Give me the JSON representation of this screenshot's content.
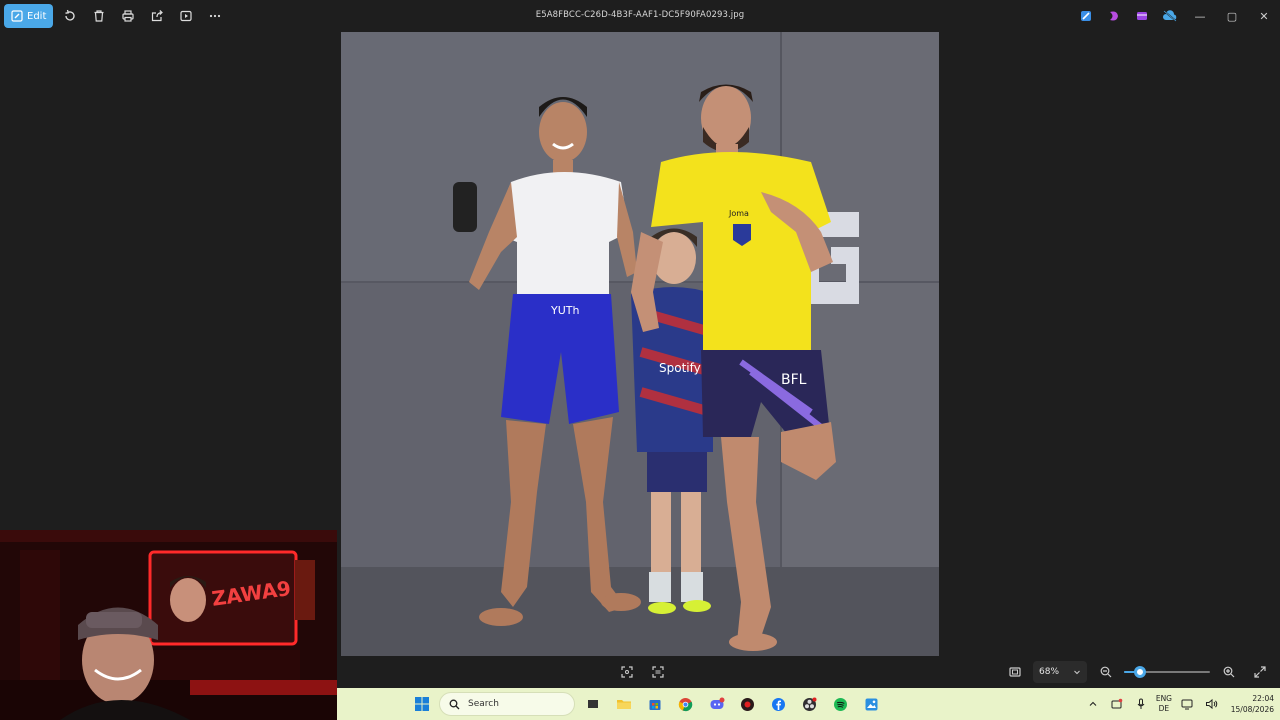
{
  "window": {
    "filename": "E5A8FBCC-C26D-4B3F-AAF1-DC5F90FA0293.jpg",
    "edit_label": "Edit",
    "toolbar_icons": [
      "rotate-icon",
      "delete-icon",
      "print-icon",
      "share-icon",
      "slideshow-icon",
      "more-icon"
    ],
    "controls": {
      "minimize": "—",
      "maximize": "▢",
      "close": "✕"
    }
  },
  "bottom_bar": {
    "zoom_value": "68%",
    "zoom_level": 0.13
  },
  "webcam": {
    "sign_text": "ZAWA9"
  },
  "photo": {
    "shirt_brand": "Joma",
    "shorts_left": "YUTh",
    "shorts_right": "BFL",
    "kid_sponsor": "Spotify"
  },
  "taskbar": {
    "search_placeholder": "Search",
    "language_top": "ENG",
    "language_bottom": "DE",
    "time": "22:04",
    "date": "15/08/2026"
  },
  "colors": {
    "accent": "#4aa8e8",
    "taskbar": "#e9f3c9",
    "background": "#1e1e1e"
  }
}
